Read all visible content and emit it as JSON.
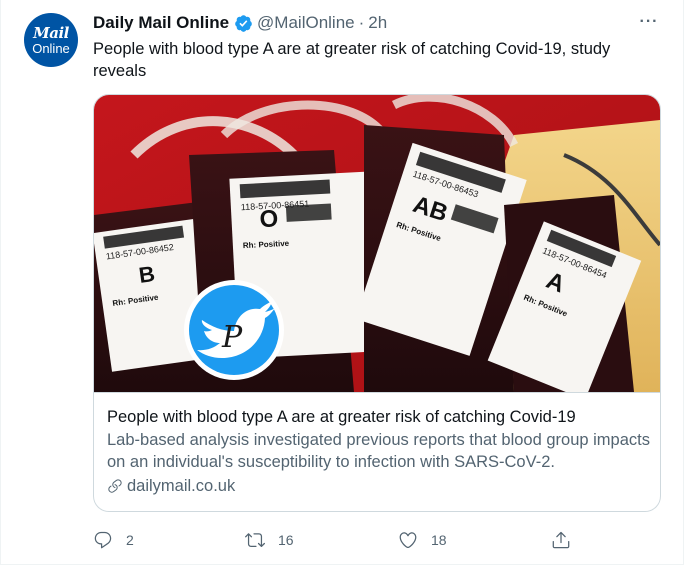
{
  "account": {
    "avatar_line1": "Mail",
    "avatar_line2": "Online",
    "name": "Daily Mail Online",
    "handle": "@MailOnline",
    "separator": "·",
    "time": "2h",
    "verified": true
  },
  "tweet": {
    "text": "People with blood type A are at greater risk of catching Covid-19, study reveals"
  },
  "card": {
    "image_labels": {
      "bag_b_id": "118-57-00-86452",
      "bag_o_id": "118-57-00-86451",
      "bag_ab_id": "118-57-00-86453",
      "bag_a_id": "118-57-00-86454",
      "group_b": "B",
      "group_o": "O",
      "group_ab": "AB",
      "group_a": "A",
      "rh_positive": "Rh: Positive",
      "watermark_letter": "P"
    },
    "title": "People with blood type A are at greater risk of catching Covid-19",
    "description": "Lab-based analysis investigated previous reports that blood group impacts on an individual's susceptibility to infection with SARS-CoV-2.",
    "domain": "dailymail.co.uk"
  },
  "actions": {
    "reply_count": "2",
    "retweet_count": "16",
    "like_count": "18"
  },
  "colors": {
    "verified": "#1d9bf0",
    "avatar_bg": "#0054a4",
    "text_primary": "#0f1419",
    "text_secondary": "#536471",
    "border": "#cfd9de",
    "watermark_bg": "#1d9bf0"
  }
}
